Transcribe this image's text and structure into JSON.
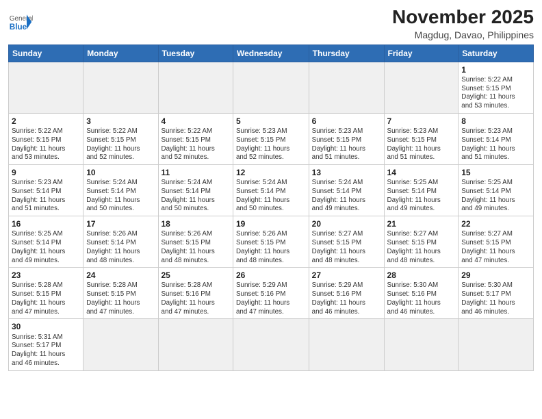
{
  "header": {
    "logo": {
      "general": "General",
      "blue": "Blue"
    },
    "title": "November 2025",
    "location": "Magdug, Davao, Philippines"
  },
  "days_of_week": [
    "Sunday",
    "Monday",
    "Tuesday",
    "Wednesday",
    "Thursday",
    "Friday",
    "Saturday"
  ],
  "weeks": [
    [
      {
        "day": "",
        "info": ""
      },
      {
        "day": "",
        "info": ""
      },
      {
        "day": "",
        "info": ""
      },
      {
        "day": "",
        "info": ""
      },
      {
        "day": "",
        "info": ""
      },
      {
        "day": "",
        "info": ""
      },
      {
        "day": "1",
        "info": "Sunrise: 5:22 AM\nSunset: 5:15 PM\nDaylight: 11 hours\nand 53 minutes."
      }
    ],
    [
      {
        "day": "2",
        "info": "Sunrise: 5:22 AM\nSunset: 5:15 PM\nDaylight: 11 hours\nand 53 minutes."
      },
      {
        "day": "3",
        "info": "Sunrise: 5:22 AM\nSunset: 5:15 PM\nDaylight: 11 hours\nand 52 minutes."
      },
      {
        "day": "4",
        "info": "Sunrise: 5:22 AM\nSunset: 5:15 PM\nDaylight: 11 hours\nand 52 minutes."
      },
      {
        "day": "5",
        "info": "Sunrise: 5:23 AM\nSunset: 5:15 PM\nDaylight: 11 hours\nand 52 minutes."
      },
      {
        "day": "6",
        "info": "Sunrise: 5:23 AM\nSunset: 5:15 PM\nDaylight: 11 hours\nand 51 minutes."
      },
      {
        "day": "7",
        "info": "Sunrise: 5:23 AM\nSunset: 5:15 PM\nDaylight: 11 hours\nand 51 minutes."
      },
      {
        "day": "8",
        "info": "Sunrise: 5:23 AM\nSunset: 5:14 PM\nDaylight: 11 hours\nand 51 minutes."
      }
    ],
    [
      {
        "day": "9",
        "info": "Sunrise: 5:23 AM\nSunset: 5:14 PM\nDaylight: 11 hours\nand 51 minutes."
      },
      {
        "day": "10",
        "info": "Sunrise: 5:24 AM\nSunset: 5:14 PM\nDaylight: 11 hours\nand 50 minutes."
      },
      {
        "day": "11",
        "info": "Sunrise: 5:24 AM\nSunset: 5:14 PM\nDaylight: 11 hours\nand 50 minutes."
      },
      {
        "day": "12",
        "info": "Sunrise: 5:24 AM\nSunset: 5:14 PM\nDaylight: 11 hours\nand 50 minutes."
      },
      {
        "day": "13",
        "info": "Sunrise: 5:24 AM\nSunset: 5:14 PM\nDaylight: 11 hours\nand 49 minutes."
      },
      {
        "day": "14",
        "info": "Sunrise: 5:25 AM\nSunset: 5:14 PM\nDaylight: 11 hours\nand 49 minutes."
      },
      {
        "day": "15",
        "info": "Sunrise: 5:25 AM\nSunset: 5:14 PM\nDaylight: 11 hours\nand 49 minutes."
      }
    ],
    [
      {
        "day": "16",
        "info": "Sunrise: 5:25 AM\nSunset: 5:14 PM\nDaylight: 11 hours\nand 49 minutes."
      },
      {
        "day": "17",
        "info": "Sunrise: 5:26 AM\nSunset: 5:14 PM\nDaylight: 11 hours\nand 48 minutes."
      },
      {
        "day": "18",
        "info": "Sunrise: 5:26 AM\nSunset: 5:15 PM\nDaylight: 11 hours\nand 48 minutes."
      },
      {
        "day": "19",
        "info": "Sunrise: 5:26 AM\nSunset: 5:15 PM\nDaylight: 11 hours\nand 48 minutes."
      },
      {
        "day": "20",
        "info": "Sunrise: 5:27 AM\nSunset: 5:15 PM\nDaylight: 11 hours\nand 48 minutes."
      },
      {
        "day": "21",
        "info": "Sunrise: 5:27 AM\nSunset: 5:15 PM\nDaylight: 11 hours\nand 48 minutes."
      },
      {
        "day": "22",
        "info": "Sunrise: 5:27 AM\nSunset: 5:15 PM\nDaylight: 11 hours\nand 47 minutes."
      }
    ],
    [
      {
        "day": "23",
        "info": "Sunrise: 5:28 AM\nSunset: 5:15 PM\nDaylight: 11 hours\nand 47 minutes."
      },
      {
        "day": "24",
        "info": "Sunrise: 5:28 AM\nSunset: 5:15 PM\nDaylight: 11 hours\nand 47 minutes."
      },
      {
        "day": "25",
        "info": "Sunrise: 5:28 AM\nSunset: 5:16 PM\nDaylight: 11 hours\nand 47 minutes."
      },
      {
        "day": "26",
        "info": "Sunrise: 5:29 AM\nSunset: 5:16 PM\nDaylight: 11 hours\nand 47 minutes."
      },
      {
        "day": "27",
        "info": "Sunrise: 5:29 AM\nSunset: 5:16 PM\nDaylight: 11 hours\nand 46 minutes."
      },
      {
        "day": "28",
        "info": "Sunrise: 5:30 AM\nSunset: 5:16 PM\nDaylight: 11 hours\nand 46 minutes."
      },
      {
        "day": "29",
        "info": "Sunrise: 5:30 AM\nSunset: 5:17 PM\nDaylight: 11 hours\nand 46 minutes."
      }
    ],
    [
      {
        "day": "30",
        "info": "Sunrise: 5:31 AM\nSunset: 5:17 PM\nDaylight: 11 hours\nand 46 minutes."
      },
      {
        "day": "",
        "info": ""
      },
      {
        "day": "",
        "info": ""
      },
      {
        "day": "",
        "info": ""
      },
      {
        "day": "",
        "info": ""
      },
      {
        "day": "",
        "info": ""
      },
      {
        "day": "",
        "info": ""
      }
    ]
  ]
}
